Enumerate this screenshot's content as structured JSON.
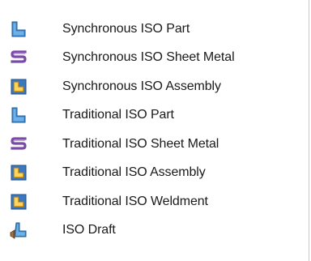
{
  "menu": {
    "items": [
      {
        "label": "Synchronous ISO Part",
        "icon": "part-icon"
      },
      {
        "label": "Synchronous ISO Sheet Metal",
        "icon": "sheet-metal-icon"
      },
      {
        "label": "Synchronous ISO Assembly",
        "icon": "assembly-icon"
      },
      {
        "label": "Traditional ISO Part",
        "icon": "part-icon"
      },
      {
        "label": "Traditional ISO Sheet Metal",
        "icon": "sheet-metal-icon"
      },
      {
        "label": "Traditional ISO Assembly",
        "icon": "assembly-icon"
      },
      {
        "label": "Traditional ISO Weldment",
        "icon": "weldment-icon"
      },
      {
        "label": "ISO Draft",
        "icon": "draft-icon"
      }
    ]
  },
  "colors": {
    "part_blue": "#3f88c9",
    "sheet_metal_purple": "#7a4aa8",
    "assembly_yellow": "#f2b52a",
    "assembly_blue": "#3a78c0",
    "draft_brown": "#8a5a2b"
  }
}
